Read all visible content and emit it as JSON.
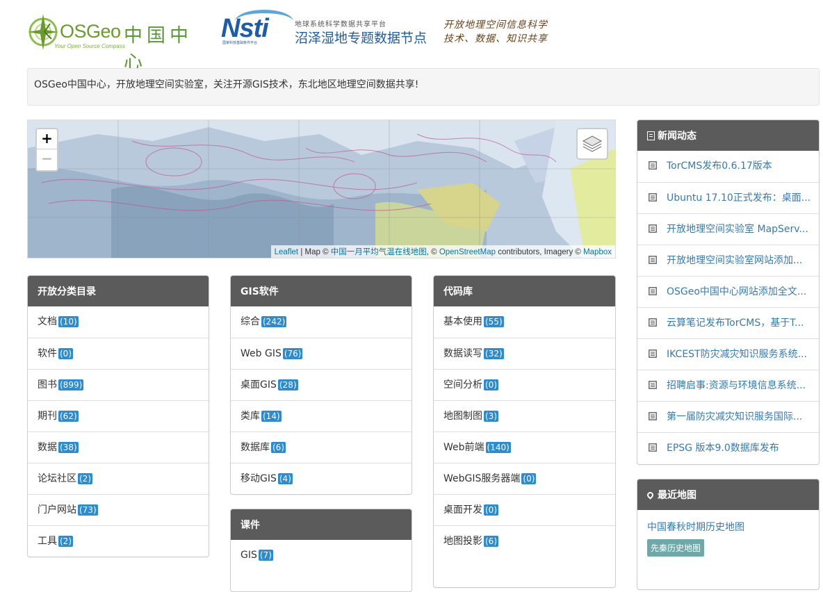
{
  "header": {
    "osgeo_name": "OSGeo",
    "osgeo_cn": "中国中心",
    "osgeo_tagline": "Your Open Source Compass",
    "nsti_word": "Nsti",
    "nsti_sub": "国家科技基础条件平台",
    "nsti_line1": "地球系统科学数据共享平台",
    "nsti_line2": "沼泽湿地专题数据节点",
    "slogan_line1": "开放地理空间信息科学",
    "slogan_line2": "技术、数据、知识共享"
  },
  "notice": "OSGeo中国中心，开放地理空间实验室，关注开源GIS技术，东北地区地理空间数据共享!",
  "map": {
    "zoom_in": "+",
    "zoom_out": "−",
    "attr_leaflet": "Leaflet",
    "attr_sep1": " | Map © ",
    "attr_map": "中国一月平均气温在线地图",
    "attr_sep2": ", © ",
    "attr_osm": "OpenStreetMap",
    "attr_sep3": " contributors, Imagery © ",
    "attr_mapbox": "Mapbox"
  },
  "catalog": {
    "title": "开放分类目录",
    "items": [
      {
        "label": "文档",
        "count": "(10)"
      },
      {
        "label": "软件",
        "count": "(0)"
      },
      {
        "label": "图书",
        "count": "(899)"
      },
      {
        "label": "期刊",
        "count": "(62)"
      },
      {
        "label": "数据",
        "count": "(38)"
      },
      {
        "label": "论坛社区",
        "count": "(2)"
      },
      {
        "label": "门户网站",
        "count": "(73)"
      },
      {
        "label": "工具",
        "count": "(2)"
      }
    ]
  },
  "gis": {
    "title": "GIS软件",
    "items": [
      {
        "label": "综合",
        "count": "(242)"
      },
      {
        "label": "Web GIS",
        "count": "(76)"
      },
      {
        "label": "桌面GIS",
        "count": "(28)"
      },
      {
        "label": "类库",
        "count": "(14)"
      },
      {
        "label": "数据库",
        "count": "(6)"
      },
      {
        "label": "移动GIS",
        "count": "(4)"
      }
    ]
  },
  "courseware": {
    "title": "课件",
    "items": [
      {
        "label": "GIS",
        "count": "(7)"
      }
    ]
  },
  "code": {
    "title": "代码库",
    "items": [
      {
        "label": "基本使用",
        "count": "(55)"
      },
      {
        "label": "数据读写",
        "count": "(32)"
      },
      {
        "label": "空间分析",
        "count": "(0)"
      },
      {
        "label": "地图制图",
        "count": "(3)"
      },
      {
        "label": "Web前端",
        "count": "(140)"
      },
      {
        "label": "WebGIS服务器端",
        "count": "(0)"
      },
      {
        "label": "桌面开发",
        "count": "(0)"
      },
      {
        "label": "地图投影",
        "count": "(6)"
      }
    ]
  },
  "news": {
    "title": "新闻动态",
    "items": [
      "TorCMS发布0.6.17版本",
      "Ubuntu 17.10正式发布：桌面...",
      "开放地理空间实验室 MapServ...",
      "开放地理空间实验室网站添加...",
      "OSGeo中国中心网站添加全文...",
      "云算笔记发布TorCMS，基于T...",
      "IKCEST防灾减灾知识服务系统...",
      "招聘启事:资源与环境信息系统...",
      "第一届防灾减灾知识服务国际...",
      "EPSG 版本9.0数据库发布"
    ]
  },
  "recent_maps": {
    "title": "最近地图",
    "item": "中国春秋时期历史地图",
    "tag": "先秦历史地图"
  }
}
